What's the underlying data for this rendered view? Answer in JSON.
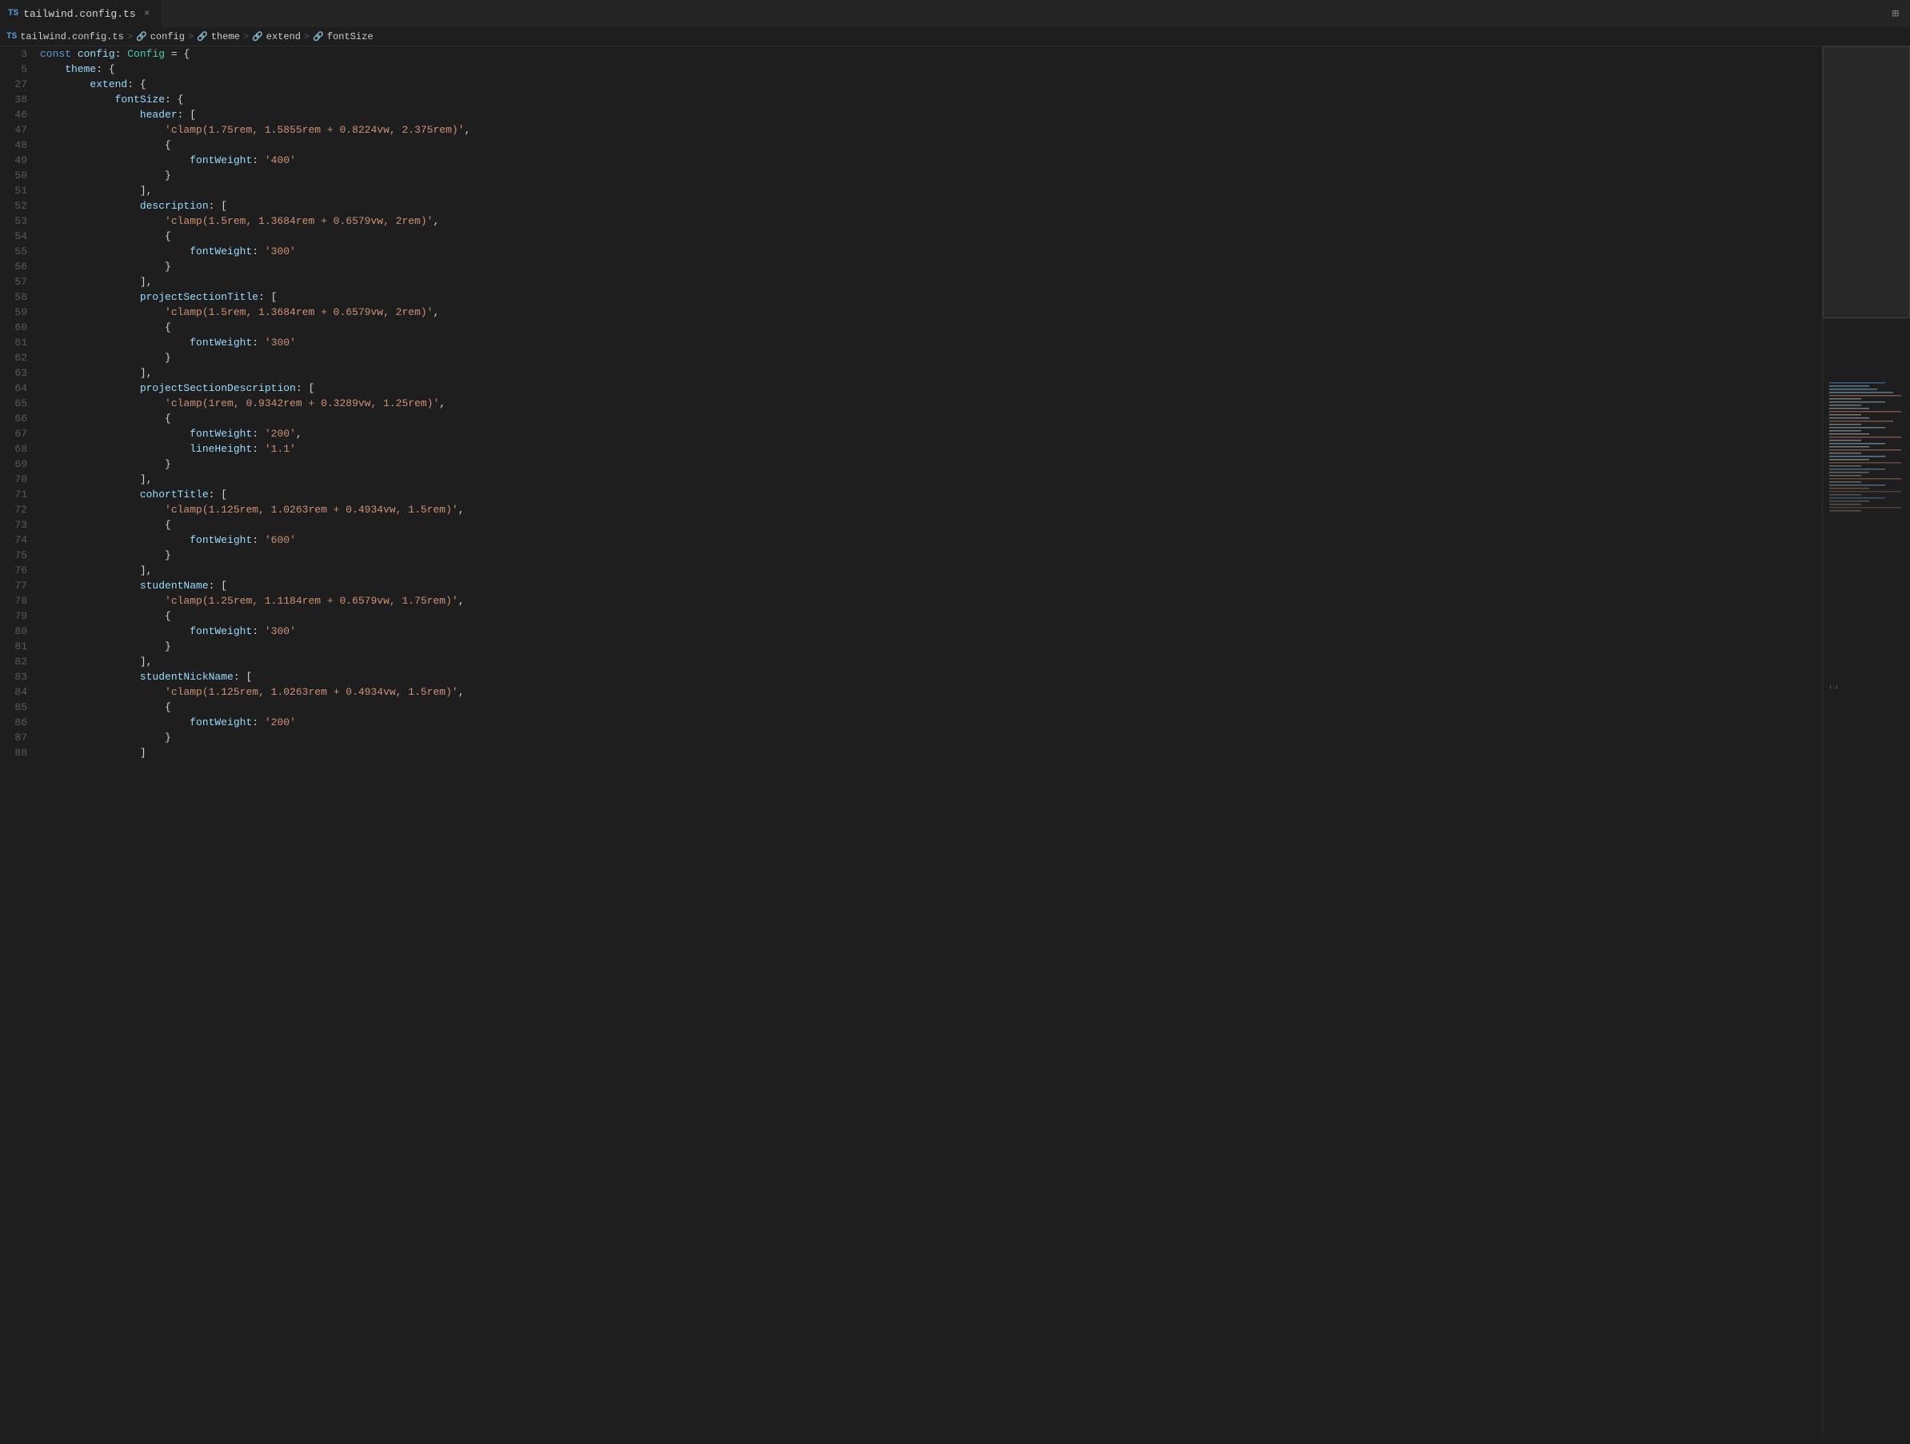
{
  "tab": {
    "ts_badge": "TS",
    "filename": "tailwind.config.ts",
    "close_icon": "×"
  },
  "tab_actions": {
    "split_icon": "⊞"
  },
  "breadcrumb": {
    "ts_badge": "TS",
    "file": "tailwind.config.ts",
    "sep1": ">",
    "part1": "config",
    "sep2": ">",
    "part2": "theme",
    "sep3": ">",
    "part3": "extend",
    "sep4": ">",
    "part4": "fontSize"
  },
  "lines": [
    {
      "num": "3",
      "tokens": [
        {
          "t": "kw",
          "v": "const "
        },
        {
          "t": "plain",
          "v": "config"
        },
        {
          "t": "punct",
          "v": ": "
        },
        {
          "t": "type",
          "v": "Config"
        },
        {
          "t": "punct",
          "v": " = {"
        }
      ]
    },
    {
      "num": "5",
      "tokens": [
        {
          "t": "plain",
          "v": "    theme"
        },
        {
          "t": "punct",
          "v": ": {"
        }
      ]
    },
    {
      "num": "27",
      "tokens": [
        {
          "t": "plain",
          "v": "        extend"
        },
        {
          "t": "punct",
          "v": ": {"
        }
      ]
    },
    {
      "num": "38",
      "tokens": [
        {
          "t": "plain",
          "v": "            fontSize"
        },
        {
          "t": "punct",
          "v": ": {"
        }
      ]
    },
    {
      "num": "46",
      "tokens": [
        {
          "t": "plain",
          "v": "                header"
        },
        {
          "t": "punct",
          "v": ": ["
        }
      ]
    },
    {
      "num": "47",
      "tokens": [
        {
          "t": "plain",
          "v": "                    "
        },
        {
          "t": "str",
          "v": "'clamp(1.75rem, 1.5855rem + 0.8224vw, 2.375rem)'"
        },
        {
          "t": "punct",
          "v": ","
        }
      ]
    },
    {
      "num": "48",
      "tokens": [
        {
          "t": "plain",
          "v": "                    "
        },
        {
          "t": "punct",
          "v": "{"
        }
      ]
    },
    {
      "num": "49",
      "tokens": [
        {
          "t": "plain",
          "v": "                        fontWeight"
        },
        {
          "t": "punct",
          "v": ": "
        },
        {
          "t": "str",
          "v": "'400'"
        }
      ]
    },
    {
      "num": "50",
      "tokens": [
        {
          "t": "plain",
          "v": "                    "
        },
        {
          "t": "punct",
          "v": "}"
        }
      ]
    },
    {
      "num": "51",
      "tokens": [
        {
          "t": "plain",
          "v": "                "
        },
        {
          "t": "punct",
          "v": "],"
        }
      ]
    },
    {
      "num": "52",
      "tokens": [
        {
          "t": "plain",
          "v": "                description"
        },
        {
          "t": "punct",
          "v": ": ["
        }
      ]
    },
    {
      "num": "53",
      "tokens": [
        {
          "t": "plain",
          "v": "                    "
        },
        {
          "t": "str",
          "v": "'clamp(1.5rem, 1.3684rem + 0.6579vw, 2rem)'"
        },
        {
          "t": "punct",
          "v": ","
        }
      ]
    },
    {
      "num": "54",
      "tokens": [
        {
          "t": "plain",
          "v": "                    "
        },
        {
          "t": "punct",
          "v": "{"
        }
      ]
    },
    {
      "num": "55",
      "tokens": [
        {
          "t": "plain",
          "v": "                        fontWeight"
        },
        {
          "t": "punct",
          "v": ": "
        },
        {
          "t": "str",
          "v": "'300'"
        }
      ]
    },
    {
      "num": "56",
      "tokens": [
        {
          "t": "plain",
          "v": "                    "
        },
        {
          "t": "punct",
          "v": "}"
        }
      ]
    },
    {
      "num": "57",
      "tokens": [
        {
          "t": "plain",
          "v": "                "
        },
        {
          "t": "punct",
          "v": "],"
        }
      ]
    },
    {
      "num": "58",
      "tokens": [
        {
          "t": "plain",
          "v": "                projectSectionTitle"
        },
        {
          "t": "punct",
          "v": ": ["
        }
      ]
    },
    {
      "num": "59",
      "tokens": [
        {
          "t": "plain",
          "v": "                    "
        },
        {
          "t": "str",
          "v": "'clamp(1.5rem, 1.3684rem + 0.6579vw, 2rem)'"
        },
        {
          "t": "punct",
          "v": ","
        }
      ]
    },
    {
      "num": "60",
      "tokens": [
        {
          "t": "plain",
          "v": "                    "
        },
        {
          "t": "punct",
          "v": "{"
        }
      ]
    },
    {
      "num": "61",
      "tokens": [
        {
          "t": "plain",
          "v": "                        fontWeight"
        },
        {
          "t": "punct",
          "v": ": "
        },
        {
          "t": "str",
          "v": "'300'"
        }
      ]
    },
    {
      "num": "62",
      "tokens": [
        {
          "t": "plain",
          "v": "                    "
        },
        {
          "t": "punct",
          "v": "}"
        }
      ]
    },
    {
      "num": "63",
      "tokens": [
        {
          "t": "plain",
          "v": "                "
        },
        {
          "t": "punct",
          "v": "],"
        }
      ]
    },
    {
      "num": "64",
      "tokens": [
        {
          "t": "plain",
          "v": "                projectSectionDescription"
        },
        {
          "t": "punct",
          "v": ": ["
        }
      ]
    },
    {
      "num": "65",
      "tokens": [
        {
          "t": "plain",
          "v": "                    "
        },
        {
          "t": "str",
          "v": "'clamp(1rem, 0.9342rem + 0.3289vw, 1.25rem)'"
        },
        {
          "t": "punct",
          "v": ","
        }
      ]
    },
    {
      "num": "66",
      "tokens": [
        {
          "t": "plain",
          "v": "                    "
        },
        {
          "t": "punct",
          "v": "{"
        }
      ]
    },
    {
      "num": "67",
      "tokens": [
        {
          "t": "plain",
          "v": "                        fontWeight"
        },
        {
          "t": "punct",
          "v": ": "
        },
        {
          "t": "str",
          "v": "'200'"
        },
        {
          "t": "punct",
          "v": ","
        }
      ]
    },
    {
      "num": "68",
      "tokens": [
        {
          "t": "plain",
          "v": "                        lineHeight"
        },
        {
          "t": "punct",
          "v": ": "
        },
        {
          "t": "str",
          "v": "'1.1'"
        }
      ]
    },
    {
      "num": "69",
      "tokens": [
        {
          "t": "plain",
          "v": "                    "
        },
        {
          "t": "punct",
          "v": "}"
        }
      ]
    },
    {
      "num": "70",
      "tokens": [
        {
          "t": "plain",
          "v": "                "
        },
        {
          "t": "punct",
          "v": "],"
        }
      ]
    },
    {
      "num": "71",
      "tokens": [
        {
          "t": "plain",
          "v": "                cohortTitle"
        },
        {
          "t": "punct",
          "v": ": ["
        }
      ]
    },
    {
      "num": "72",
      "tokens": [
        {
          "t": "plain",
          "v": "                    "
        },
        {
          "t": "str",
          "v": "'clamp(1.125rem, 1.0263rem + 0.4934vw, 1.5rem)'"
        },
        {
          "t": "punct",
          "v": ","
        }
      ]
    },
    {
      "num": "73",
      "tokens": [
        {
          "t": "plain",
          "v": "                    "
        },
        {
          "t": "punct",
          "v": "{"
        }
      ]
    },
    {
      "num": "74",
      "tokens": [
        {
          "t": "plain",
          "v": "                        fontWeight"
        },
        {
          "t": "punct",
          "v": ": "
        },
        {
          "t": "str",
          "v": "'600'"
        }
      ]
    },
    {
      "num": "75",
      "tokens": [
        {
          "t": "plain",
          "v": "                    "
        },
        {
          "t": "punct",
          "v": "}"
        }
      ]
    },
    {
      "num": "76",
      "tokens": [
        {
          "t": "plain",
          "v": "                "
        },
        {
          "t": "punct",
          "v": "],"
        }
      ]
    },
    {
      "num": "77",
      "tokens": [
        {
          "t": "plain",
          "v": "                studentName"
        },
        {
          "t": "punct",
          "v": ": ["
        }
      ]
    },
    {
      "num": "78",
      "tokens": [
        {
          "t": "plain",
          "v": "                    "
        },
        {
          "t": "str",
          "v": "'clamp(1.25rem, 1.1184rem + 0.6579vw, 1.75rem)'"
        },
        {
          "t": "punct",
          "v": ","
        }
      ]
    },
    {
      "num": "79",
      "tokens": [
        {
          "t": "plain",
          "v": "                    "
        },
        {
          "t": "punct",
          "v": "{"
        }
      ]
    },
    {
      "num": "80",
      "tokens": [
        {
          "t": "plain",
          "v": "                        fontWeight"
        },
        {
          "t": "punct",
          "v": ": "
        },
        {
          "t": "str",
          "v": "'300'"
        }
      ]
    },
    {
      "num": "81",
      "tokens": [
        {
          "t": "plain",
          "v": "                    "
        },
        {
          "t": "punct",
          "v": "}"
        }
      ]
    },
    {
      "num": "82",
      "tokens": [
        {
          "t": "plain",
          "v": "                "
        },
        {
          "t": "punct",
          "v": "],"
        }
      ]
    },
    {
      "num": "83",
      "tokens": [
        {
          "t": "plain",
          "v": "                studentNickName"
        },
        {
          "t": "punct",
          "v": ": ["
        }
      ]
    },
    {
      "num": "84",
      "tokens": [
        {
          "t": "plain",
          "v": "                    "
        },
        {
          "t": "str",
          "v": "'clamp(1.125rem, 1.0263rem + 0.4934vw, 1.5rem)'"
        },
        {
          "t": "punct",
          "v": ","
        }
      ]
    },
    {
      "num": "85",
      "tokens": [
        {
          "t": "plain",
          "v": "                    "
        },
        {
          "t": "punct",
          "v": "{"
        }
      ]
    },
    {
      "num": "86",
      "tokens": [
        {
          "t": "plain",
          "v": "                        fontWeight"
        },
        {
          "t": "punct",
          "v": ": "
        },
        {
          "t": "str",
          "v": "'200'"
        }
      ]
    },
    {
      "num": "87",
      "tokens": [
        {
          "t": "plain",
          "v": "                    "
        },
        {
          "t": "punct",
          "v": "}"
        }
      ]
    },
    {
      "num": "88",
      "tokens": [
        {
          "t": "plain",
          "v": "                "
        },
        {
          "t": "punct",
          "v": "]"
        }
      ]
    }
  ]
}
